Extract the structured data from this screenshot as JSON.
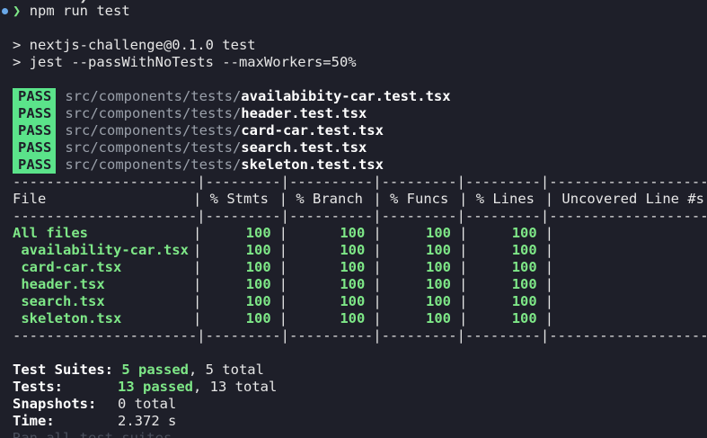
{
  "terminal": {
    "top_cut_text": "        ❯   ",
    "prompt": {
      "arrow": "❯",
      "command": "npm run test"
    },
    "script_lines": [
      "> nextjs-challenge@0.1.0 test",
      "> jest --passWithNoTests --maxWorkers=50%"
    ],
    "badge_label": "PASS",
    "results": [
      {
        "dir": "src/components/tests/",
        "file": "availabibity-car.test.tsx"
      },
      {
        "dir": "src/components/tests/",
        "file": "header.test.tsx"
      },
      {
        "dir": "src/components/tests/",
        "file": "card-car.test.tsx"
      },
      {
        "dir": "src/components/tests/",
        "file": "search.test.tsx"
      },
      {
        "dir": "src/components/tests/",
        "file": "skeleton.test.tsx"
      }
    ],
    "coverage": {
      "separator": "----------------------|---------|----------|---------|---------|-------------------",
      "header": {
        "file": "File",
        "stmts": "% Stmts",
        "branch": "% Branch",
        "funcs": "% Funcs",
        "lines": "% Lines",
        "uncovered": "Uncovered Line #s"
      },
      "rows": [
        {
          "file": "All files",
          "stmts": "100",
          "branch": "100",
          "funcs": "100",
          "lines": "100",
          "uncovered": ""
        },
        {
          "file": " availability-car.tsx",
          "stmts": "100",
          "branch": "100",
          "funcs": "100",
          "lines": "100",
          "uncovered": ""
        },
        {
          "file": " card-car.tsx",
          "stmts": "100",
          "branch": "100",
          "funcs": "100",
          "lines": "100",
          "uncovered": ""
        },
        {
          "file": " header.tsx",
          "stmts": "100",
          "branch": "100",
          "funcs": "100",
          "lines": "100",
          "uncovered": ""
        },
        {
          "file": " search.tsx",
          "stmts": "100",
          "branch": "100",
          "funcs": "100",
          "lines": "100",
          "uncovered": ""
        },
        {
          "file": " skeleton.tsx",
          "stmts": "100",
          "branch": "100",
          "funcs": "100",
          "lines": "100",
          "uncovered": ""
        }
      ]
    },
    "summary": {
      "suites_label": "Test Suites:",
      "suites_passed": "5 passed",
      "suites_total": ", 5 total",
      "tests_label": "Tests:",
      "tests_passed": "13 passed",
      "tests_total": ", 13 total",
      "snapshots_label": "Snapshots:",
      "snapshots_value": "0 total",
      "time_label": "Time:",
      "time_value": "2.372 s",
      "footer_hint": "Ran all test suites."
    },
    "colors": {
      "background": "#1e1f29",
      "pass_badge": "#5be38a",
      "success_text": "#7ee787",
      "dim_path": "#9aa0aa",
      "prompt_dot": "#6aa8e8"
    }
  }
}
